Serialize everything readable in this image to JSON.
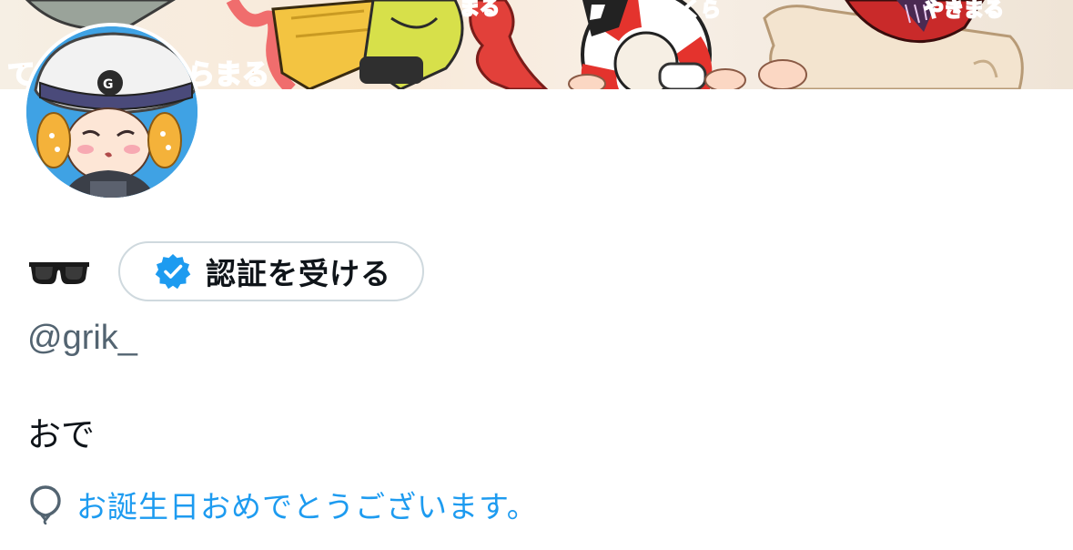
{
  "profile": {
    "display_name_emoji": "sunglasses",
    "verify_button_label": "認証を受ける",
    "handle": "@grik_",
    "bio": "おで",
    "birthday_text": "お誕生日おめでとうございます。"
  },
  "banner": {
    "decorative_text": [
      "て",
      "らまる",
      "まる",
      "くら",
      "やきまる"
    ]
  },
  "colors": {
    "accent": "#1d9bf0",
    "text_primary": "#0f1419",
    "text_secondary": "#536471",
    "border": "#cfd9de"
  },
  "icons": {
    "verify": "verified-badge-icon",
    "birthday": "balloon-icon",
    "name_emoji": "sunglasses-icon"
  }
}
